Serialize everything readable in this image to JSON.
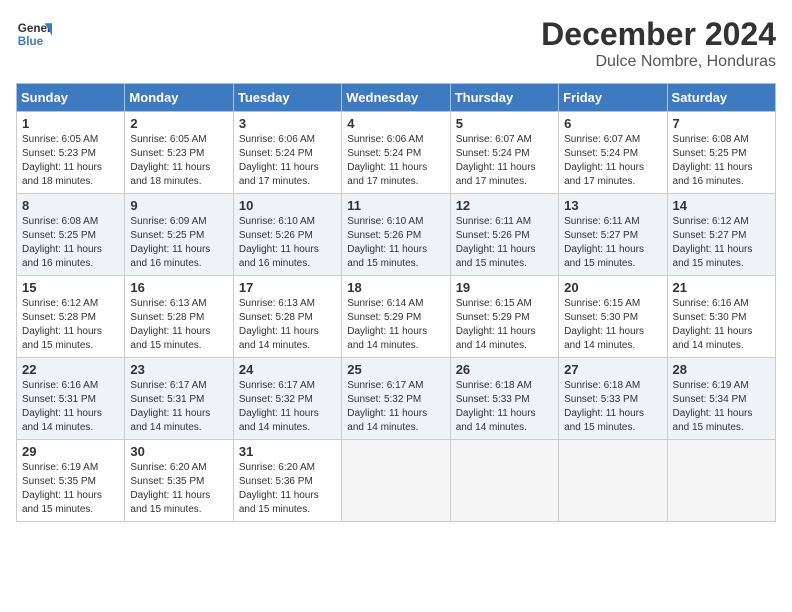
{
  "header": {
    "logo_line1": "General",
    "logo_line2": "Blue",
    "month": "December 2024",
    "location": "Dulce Nombre, Honduras"
  },
  "weekdays": [
    "Sunday",
    "Monday",
    "Tuesday",
    "Wednesday",
    "Thursday",
    "Friday",
    "Saturday"
  ],
  "weeks": [
    [
      {
        "day": "1",
        "info": "Sunrise: 6:05 AM\nSunset: 5:23 PM\nDaylight: 11 hours\nand 18 minutes."
      },
      {
        "day": "2",
        "info": "Sunrise: 6:05 AM\nSunset: 5:23 PM\nDaylight: 11 hours\nand 18 minutes."
      },
      {
        "day": "3",
        "info": "Sunrise: 6:06 AM\nSunset: 5:24 PM\nDaylight: 11 hours\nand 17 minutes."
      },
      {
        "day": "4",
        "info": "Sunrise: 6:06 AM\nSunset: 5:24 PM\nDaylight: 11 hours\nand 17 minutes."
      },
      {
        "day": "5",
        "info": "Sunrise: 6:07 AM\nSunset: 5:24 PM\nDaylight: 11 hours\nand 17 minutes."
      },
      {
        "day": "6",
        "info": "Sunrise: 6:07 AM\nSunset: 5:24 PM\nDaylight: 11 hours\nand 17 minutes."
      },
      {
        "day": "7",
        "info": "Sunrise: 6:08 AM\nSunset: 5:25 PM\nDaylight: 11 hours\nand 16 minutes."
      }
    ],
    [
      {
        "day": "8",
        "info": "Sunrise: 6:08 AM\nSunset: 5:25 PM\nDaylight: 11 hours\nand 16 minutes."
      },
      {
        "day": "9",
        "info": "Sunrise: 6:09 AM\nSunset: 5:25 PM\nDaylight: 11 hours\nand 16 minutes."
      },
      {
        "day": "10",
        "info": "Sunrise: 6:10 AM\nSunset: 5:26 PM\nDaylight: 11 hours\nand 16 minutes."
      },
      {
        "day": "11",
        "info": "Sunrise: 6:10 AM\nSunset: 5:26 PM\nDaylight: 11 hours\nand 15 minutes."
      },
      {
        "day": "12",
        "info": "Sunrise: 6:11 AM\nSunset: 5:26 PM\nDaylight: 11 hours\nand 15 minutes."
      },
      {
        "day": "13",
        "info": "Sunrise: 6:11 AM\nSunset: 5:27 PM\nDaylight: 11 hours\nand 15 minutes."
      },
      {
        "day": "14",
        "info": "Sunrise: 6:12 AM\nSunset: 5:27 PM\nDaylight: 11 hours\nand 15 minutes."
      }
    ],
    [
      {
        "day": "15",
        "info": "Sunrise: 6:12 AM\nSunset: 5:28 PM\nDaylight: 11 hours\nand 15 minutes."
      },
      {
        "day": "16",
        "info": "Sunrise: 6:13 AM\nSunset: 5:28 PM\nDaylight: 11 hours\nand 15 minutes."
      },
      {
        "day": "17",
        "info": "Sunrise: 6:13 AM\nSunset: 5:28 PM\nDaylight: 11 hours\nand 14 minutes."
      },
      {
        "day": "18",
        "info": "Sunrise: 6:14 AM\nSunset: 5:29 PM\nDaylight: 11 hours\nand 14 minutes."
      },
      {
        "day": "19",
        "info": "Sunrise: 6:15 AM\nSunset: 5:29 PM\nDaylight: 11 hours\nand 14 minutes."
      },
      {
        "day": "20",
        "info": "Sunrise: 6:15 AM\nSunset: 5:30 PM\nDaylight: 11 hours\nand 14 minutes."
      },
      {
        "day": "21",
        "info": "Sunrise: 6:16 AM\nSunset: 5:30 PM\nDaylight: 11 hours\nand 14 minutes."
      }
    ],
    [
      {
        "day": "22",
        "info": "Sunrise: 6:16 AM\nSunset: 5:31 PM\nDaylight: 11 hours\nand 14 minutes."
      },
      {
        "day": "23",
        "info": "Sunrise: 6:17 AM\nSunset: 5:31 PM\nDaylight: 11 hours\nand 14 minutes."
      },
      {
        "day": "24",
        "info": "Sunrise: 6:17 AM\nSunset: 5:32 PM\nDaylight: 11 hours\nand 14 minutes."
      },
      {
        "day": "25",
        "info": "Sunrise: 6:17 AM\nSunset: 5:32 PM\nDaylight: 11 hours\nand 14 minutes."
      },
      {
        "day": "26",
        "info": "Sunrise: 6:18 AM\nSunset: 5:33 PM\nDaylight: 11 hours\nand 14 minutes."
      },
      {
        "day": "27",
        "info": "Sunrise: 6:18 AM\nSunset: 5:33 PM\nDaylight: 11 hours\nand 15 minutes."
      },
      {
        "day": "28",
        "info": "Sunrise: 6:19 AM\nSunset: 5:34 PM\nDaylight: 11 hours\nand 15 minutes."
      }
    ],
    [
      {
        "day": "29",
        "info": "Sunrise: 6:19 AM\nSunset: 5:35 PM\nDaylight: 11 hours\nand 15 minutes."
      },
      {
        "day": "30",
        "info": "Sunrise: 6:20 AM\nSunset: 5:35 PM\nDaylight: 11 hours\nand 15 minutes."
      },
      {
        "day": "31",
        "info": "Sunrise: 6:20 AM\nSunset: 5:36 PM\nDaylight: 11 hours\nand 15 minutes."
      },
      null,
      null,
      null,
      null
    ]
  ]
}
